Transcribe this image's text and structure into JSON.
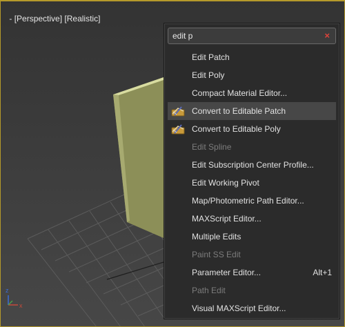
{
  "viewport": {
    "labels": {
      "menu": "-",
      "view": "[Perspective]",
      "shading": "[Realistic]"
    },
    "axis_labels": {
      "x": "x",
      "z": "z"
    }
  },
  "popup": {
    "search": {
      "value": "edit p"
    },
    "clear_glyph": "×",
    "items": [
      {
        "label": "Edit Patch",
        "shortcut": "",
        "disabled": false
      },
      {
        "label": "Edit Poly",
        "shortcut": "",
        "disabled": false
      },
      {
        "label": "Compact Material Editor...",
        "shortcut": "",
        "disabled": false
      },
      {
        "label": "Convert to Editable Patch",
        "shortcut": "",
        "disabled": false,
        "icon": "editable-patch-icon"
      },
      {
        "label": "Convert to Editable Poly",
        "shortcut": "",
        "disabled": false,
        "icon": "editable-poly-icon"
      },
      {
        "label": "Edit Spline",
        "shortcut": "",
        "disabled": true
      },
      {
        "label": "Edit Subscription Center Profile...",
        "shortcut": "",
        "disabled": false
      },
      {
        "label": "Edit Working Pivot",
        "shortcut": "",
        "disabled": false
      },
      {
        "label": "Map/Photometric Path Editor...",
        "shortcut": "",
        "disabled": false
      },
      {
        "label": "MAXScript Editor...",
        "shortcut": "",
        "disabled": false
      },
      {
        "label": "Multiple Edits",
        "shortcut": "",
        "disabled": false
      },
      {
        "label": "Paint SS Edit",
        "shortcut": "",
        "disabled": true
      },
      {
        "label": "Parameter Editor...",
        "shortcut": "Alt+1",
        "disabled": false
      },
      {
        "label": "Path Edit",
        "shortcut": "",
        "disabled": true
      },
      {
        "label": "Visual MAXScript Editor...",
        "shortcut": "",
        "disabled": false
      }
    ],
    "highlighted_index": 3
  },
  "colors": {
    "frame": "#b59a2a",
    "highlight": "#474747",
    "clear": "#e0433a"
  }
}
